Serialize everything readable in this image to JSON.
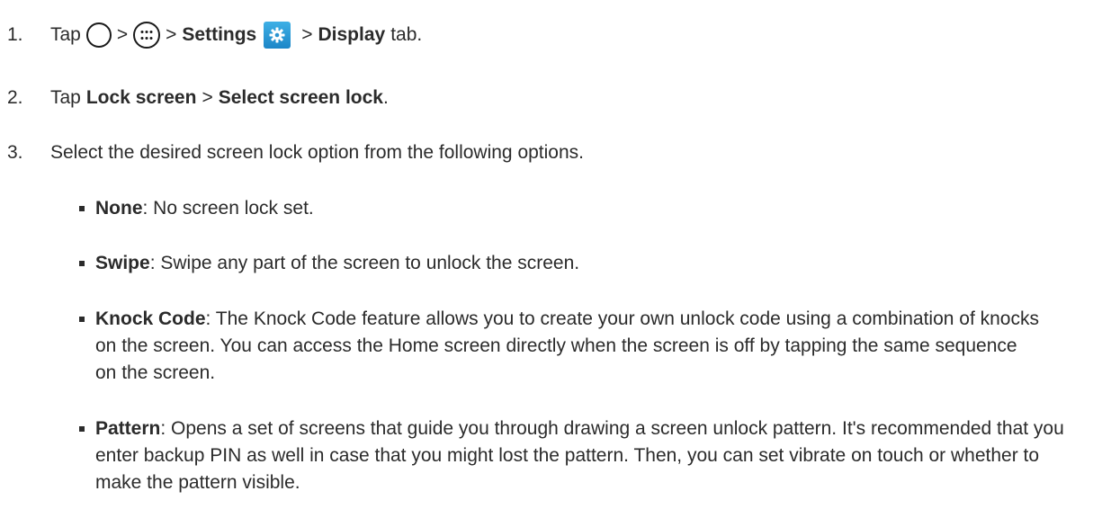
{
  "steps": [
    {
      "number": "1.",
      "tap": "Tap",
      "sep1": ">",
      "sep2": ">",
      "settings": "Settings",
      "sep3": ">",
      "display": "Display",
      "tab": "tab."
    },
    {
      "number": "2.",
      "tap": "Tap",
      "lock_screen": "Lock screen",
      "sep": ">",
      "select_lock": "Select screen lock",
      "end": "."
    },
    {
      "number": "3.",
      "text": "Select the desired screen lock option from the following options."
    }
  ],
  "options": [
    {
      "term": "None",
      "desc": ": No screen lock set."
    },
    {
      "term": "Swipe",
      "desc": ": Swipe any part of the screen to unlock the screen."
    },
    {
      "term": "Knock Code",
      "desc": ": The Knock Code feature allows you to create your own unlock code using a combination of knocks on the screen. You can access the Home screen directly when the screen is off by tapping the same sequence on the screen."
    },
    {
      "term": "Pattern",
      "desc": ": Opens a set of screens that guide you through drawing a screen unlock pattern. It's recommended that you enter backup PIN as well in case that you might lost the pattern. Then, you can set vibrate on touch or whether to make the pattern visible."
    }
  ],
  "icons": {
    "home": "home-icon",
    "apps": "apps-icon",
    "settings": "settings-icon"
  },
  "colors": {
    "text": "#2b2b2b",
    "settings_icon": "#1c86c8"
  }
}
